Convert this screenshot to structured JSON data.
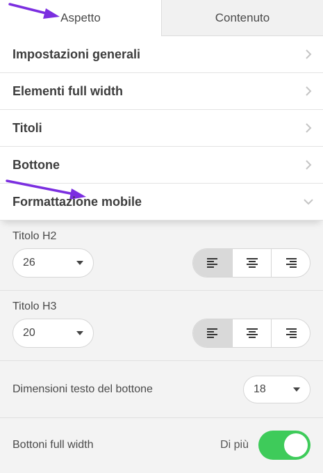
{
  "tabs": [
    {
      "label": "Aspetto",
      "active": true
    },
    {
      "label": "Contenuto",
      "active": false
    }
  ],
  "accordion": [
    {
      "label": "Impostazioni generali",
      "icon": "chevron-right-icon"
    },
    {
      "label": "Elementi full width",
      "icon": "chevron-right-icon"
    },
    {
      "label": "Titoli",
      "icon": "chevron-right-icon"
    },
    {
      "label": "Bottone",
      "icon": "chevron-right-icon"
    },
    {
      "label": "Formattazione mobile",
      "icon": "chevron-down-icon",
      "open": true
    }
  ],
  "mobile": {
    "h2": {
      "label": "Titolo H2",
      "value": "26",
      "alignment": "left"
    },
    "h3": {
      "label": "Titolo H3",
      "value": "20",
      "alignment": "left"
    },
    "button_text": {
      "label": "Dimensioni testo del bottone",
      "value": "18"
    },
    "full_width": {
      "label": "Bottoni full width",
      "more": "Di più",
      "enabled": true
    }
  },
  "colors": {
    "accent_toggle": "#3ecb5a",
    "annotation_arrow": "#7b2ee0"
  }
}
